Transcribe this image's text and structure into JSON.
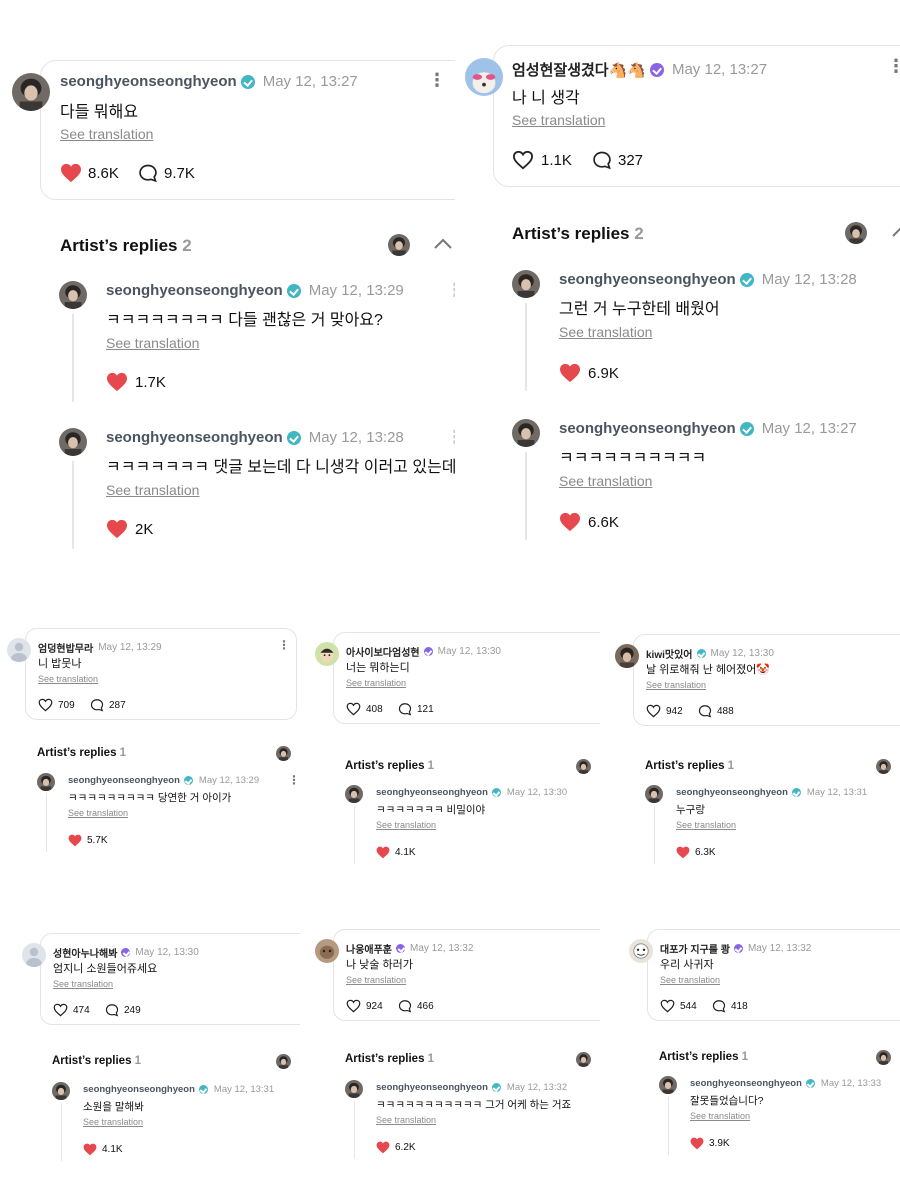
{
  "theme": {
    "heart": "#e5484d",
    "link": "#8a8a8a",
    "ts": "#9a9a9a",
    "badge_teal": "#41b6c4",
    "badge_purple": "#8a63e6"
  },
  "icons": {
    "like": "heart-outline-icon",
    "liked": "heart-filled-icon",
    "comment": "comment-bubble-icon",
    "more": "more-vertical-icon",
    "collapse": "chevron-up-icon"
  },
  "top_left": {
    "post": {
      "name": "seonghyeonseonghyeon",
      "time": "May 12, 13:27",
      "text": "다들 뭐해요",
      "translate": "See translation",
      "likes": "8.6K",
      "comments": "9.7K"
    },
    "replies_title": "Artist’s replies",
    "replies_count": "2",
    "replies": [
      {
        "name": "seonghyeonseonghyeon",
        "time": "May 12, 13:29",
        "text": "ㅋㅋㅋㅋㅋㅋㅋㅋ 다들 괜찮은 거 맞아요?",
        "translate": "See translation",
        "likes": "1.7K"
      },
      {
        "name": "seonghyeonseonghyeon",
        "time": "May 12, 13:28",
        "text": "ㅋㅋㅋㅋㅋㅋㅋ 댓글 보는데 다 니생각 이러고 있는데",
        "translate": "See translation",
        "likes": "2K"
      }
    ]
  },
  "top_right": {
    "post": {
      "name": "엄성현잘생겼다🐴🐴",
      "time": "May 12, 13:27",
      "text": "나 니 생각",
      "translate": "See translation",
      "likes": "1.1K",
      "comments": "327"
    },
    "replies_title": "Artist’s replies",
    "replies_count": "2",
    "replies": [
      {
        "name": "seonghyeonseonghyeon",
        "time": "May 12, 13:28",
        "text": "그런 거 누구한테 배웠어",
        "translate": "See translation",
        "likes": "6.9K"
      },
      {
        "name": "seonghyeonseonghyeon",
        "time": "May 12, 13:27",
        "text": "ㅋㅋㅋㅋㅋㅋㅋㅋㅋㅋ",
        "translate": "See translation",
        "likes": "6.6K"
      }
    ]
  },
  "small": [
    {
      "post": {
        "name": "엄덩현밥무라",
        "time": "May 12, 13:29",
        "text": "니 밥뭇나",
        "translate": "See translation",
        "likes": "709",
        "comments": "287"
      },
      "replies_title": "Artist’s replies",
      "replies_count": "1",
      "reply": {
        "name": "seonghyeonseonghyeon",
        "time": "May 12, 13:29",
        "text": "ㅋㅋㅋㅋㅋㅋㅋㅋㅋ 당연한 거 아이가",
        "translate": "See translation",
        "likes": "5.7K"
      }
    },
    {
      "post": {
        "name": "아사이보다엄성현",
        "time": "May 12, 13:30",
        "text": "너는 뭐하는디",
        "translate": "See translation",
        "likes": "408",
        "comments": "121"
      },
      "replies_title": "Artist’s replies",
      "replies_count": "1",
      "reply": {
        "name": "seonghyeonseonghyeon",
        "time": "May 12, 13:30",
        "text": "ㅋㅋㅋㅋㅋㅋㅋ 비밀이야",
        "translate": "See translation",
        "likes": "4.1K"
      }
    },
    {
      "post": {
        "name": "kiwi맛있어",
        "time": "May 12, 13:30",
        "text": "날 위로해줘 난 헤어졌어🤡",
        "translate": "See translation",
        "likes": "942",
        "comments": "488"
      },
      "replies_title": "Artist’s replies",
      "replies_count": "1",
      "reply": {
        "name": "seonghyeonseonghyeon",
        "time": "May 12, 13:31",
        "text": "누구랑",
        "translate": "See translation",
        "likes": "6.3K"
      }
    },
    {
      "post": {
        "name": "성현아누나해봐",
        "time": "May 12, 13:30",
        "text": "엄지니 소원들어쥬세요",
        "translate": "See translation",
        "likes": "474",
        "comments": "249"
      },
      "replies_title": "Artist’s replies",
      "replies_count": "1",
      "reply": {
        "name": "seonghyeonseonghyeon",
        "time": "May 12, 13:31",
        "text": "소원을 말해봐",
        "translate": "See translation",
        "likes": "4.1K"
      }
    },
    {
      "post": {
        "name": "나웅애푸훈",
        "time": "May 12, 13:32",
        "text": "나 낮술 하러가",
        "translate": "See translation",
        "likes": "924",
        "comments": "466"
      },
      "replies_title": "Artist’s replies",
      "replies_count": "1",
      "reply": {
        "name": "seonghyeonseonghyeon",
        "time": "May 12, 13:32",
        "text": "ㅋㅋㅋㅋㅋㅋㅋㅋㅋㅋㅋ 그거 어케 하는 거죠",
        "translate": "See translation",
        "likes": "6.2K"
      }
    },
    {
      "post": {
        "name": "대포가 지구를 쾅",
        "time": "May 12, 13:32",
        "text": "우리 사귀자",
        "translate": "See translation",
        "likes": "544",
        "comments": "418"
      },
      "replies_title": "Artist’s replies",
      "replies_count": "1",
      "reply": {
        "name": "seonghyeonseonghyeon",
        "time": "May 12, 13:33",
        "text": "잘못들었습니다?",
        "translate": "See translation",
        "likes": "3.9K"
      }
    }
  ]
}
